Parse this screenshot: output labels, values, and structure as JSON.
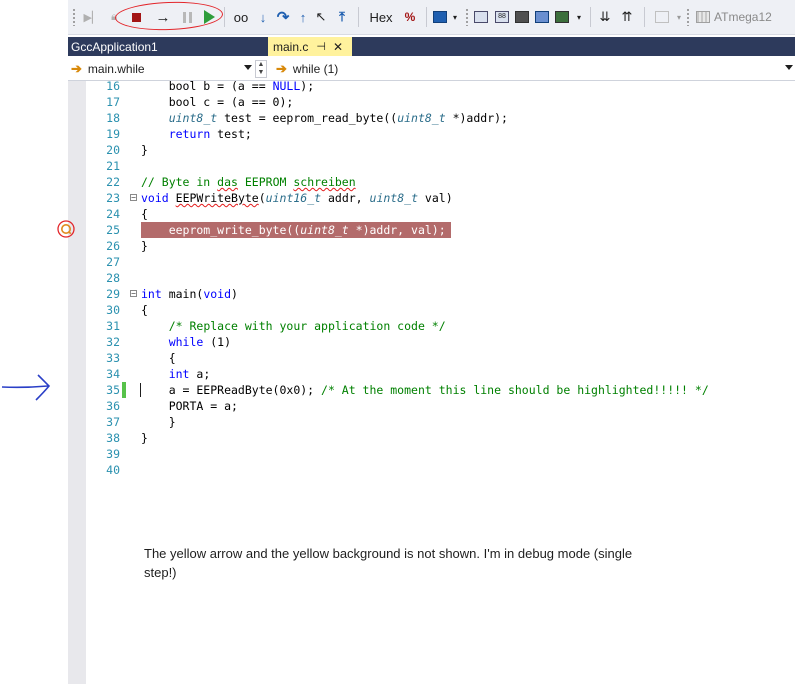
{
  "toolbar": {
    "buttons": [
      "continue-to-cursor-icon",
      "lock-icon",
      "stop-debugging-icon",
      "step-over-arrow-icon",
      "break-all-icon",
      "continue-icon",
      "watch-glasses-icon",
      "step-into-icon",
      "step-over-icon",
      "step-out-icon",
      "run-to-cursor-icon",
      "show-next-statement-icon"
    ],
    "hex_label": "Hex",
    "device_label": "ATmega12"
  },
  "tabs": [
    {
      "label": "GccApplication1",
      "active": false
    },
    {
      "label": "main.c",
      "active": true
    }
  ],
  "nav": {
    "scope": "main.while",
    "member": "while (1)"
  },
  "editor": {
    "lines": [
      {
        "n": "16",
        "parts": [
          [
            "p",
            "    bool b = (a == "
          ],
          [
            "k",
            "NULL"
          ],
          [
            "p",
            ");"
          ]
        ]
      },
      {
        "n": "17",
        "parts": [
          [
            "p",
            "    bool c = (a == 0);"
          ]
        ]
      },
      {
        "n": "18",
        "parts": [
          [
            "p",
            "    "
          ],
          [
            "t",
            "uint8_t"
          ],
          [
            "p",
            " test = eeprom_read_byte(("
          ],
          [
            "t",
            "uint8_t"
          ],
          [
            "p",
            " *)addr);"
          ]
        ]
      },
      {
        "n": "19",
        "parts": [
          [
            "p",
            "    "
          ],
          [
            "k",
            "return"
          ],
          [
            "p",
            " test;"
          ]
        ]
      },
      {
        "n": "20",
        "parts": [
          [
            "p",
            "}"
          ]
        ]
      },
      {
        "n": "21",
        "parts": []
      },
      {
        "n": "22",
        "parts": [
          [
            "c",
            "// Byte in "
          ],
          [
            "cs",
            "das"
          ],
          [
            "c",
            " EEPROM "
          ],
          [
            "cs",
            "schreiben"
          ]
        ]
      },
      {
        "n": "23",
        "fold": true,
        "parts": [
          [
            "k",
            "void"
          ],
          [
            "p",
            " "
          ],
          [
            "s",
            "EEPWriteByte"
          ],
          [
            "p",
            "("
          ],
          [
            "t",
            "uint16_t"
          ],
          [
            "p",
            " addr, "
          ],
          [
            "t",
            "uint8_t"
          ],
          [
            "p",
            " val)"
          ]
        ]
      },
      {
        "n": "24",
        "parts": [
          [
            "p",
            "{"
          ]
        ]
      },
      {
        "n": "25",
        "breakpoint": true,
        "parts": [
          [
            "p",
            "    eeprom_write_byte(("
          ],
          [
            "t",
            "uint8_t"
          ],
          [
            "p",
            " *)addr, val);"
          ]
        ]
      },
      {
        "n": "26",
        "parts": [
          [
            "p",
            "}"
          ]
        ]
      },
      {
        "n": "27",
        "parts": []
      },
      {
        "n": "28",
        "parts": []
      },
      {
        "n": "29",
        "fold": true,
        "parts": [
          [
            "k",
            "int"
          ],
          [
            "p",
            " main("
          ],
          [
            "k",
            "void"
          ],
          [
            "p",
            ")"
          ]
        ]
      },
      {
        "n": "30",
        "parts": [
          [
            "p",
            "{"
          ]
        ]
      },
      {
        "n": "31",
        "parts": [
          [
            "p",
            "    "
          ],
          [
            "c",
            "/* Replace with your application code */"
          ]
        ]
      },
      {
        "n": "32",
        "parts": [
          [
            "p",
            "    "
          ],
          [
            "k",
            "while"
          ],
          [
            "p",
            " (1)"
          ]
        ]
      },
      {
        "n": "33",
        "parts": [
          [
            "p",
            "    {"
          ]
        ]
      },
      {
        "n": "34",
        "parts": [
          [
            "p",
            "    "
          ],
          [
            "k",
            "int"
          ],
          [
            "p",
            " a;"
          ]
        ]
      },
      {
        "n": "35",
        "changed": true,
        "caret": true,
        "parts": [
          [
            "p",
            "    a = EEPReadByte(0x0); "
          ],
          [
            "c",
            "/* At the moment this line should be highlighted!!!!! */"
          ]
        ]
      },
      {
        "n": "36",
        "parts": [
          [
            "p",
            "    PORTA = a;"
          ]
        ]
      },
      {
        "n": "37",
        "parts": [
          [
            "p",
            "    }"
          ]
        ]
      },
      {
        "n": "38",
        "parts": [
          [
            "p",
            "}"
          ]
        ]
      },
      {
        "n": "39",
        "parts": []
      },
      {
        "n": "40",
        "parts": []
      }
    ]
  },
  "note": "The yellow arrow and the yellow background is not shown. I'm in debug mode (single step!)",
  "colors": {
    "keyword": "#0000ff",
    "type": "#2b6d8a",
    "comment": "#008000",
    "line_number": "#2b91af",
    "breakpoint_line": "#b36b6b",
    "ink_red": "#e3262b",
    "ink_blue": "#2a3fc7",
    "tabbar": "#2d3a5c",
    "active_tab": "#fff29d"
  }
}
